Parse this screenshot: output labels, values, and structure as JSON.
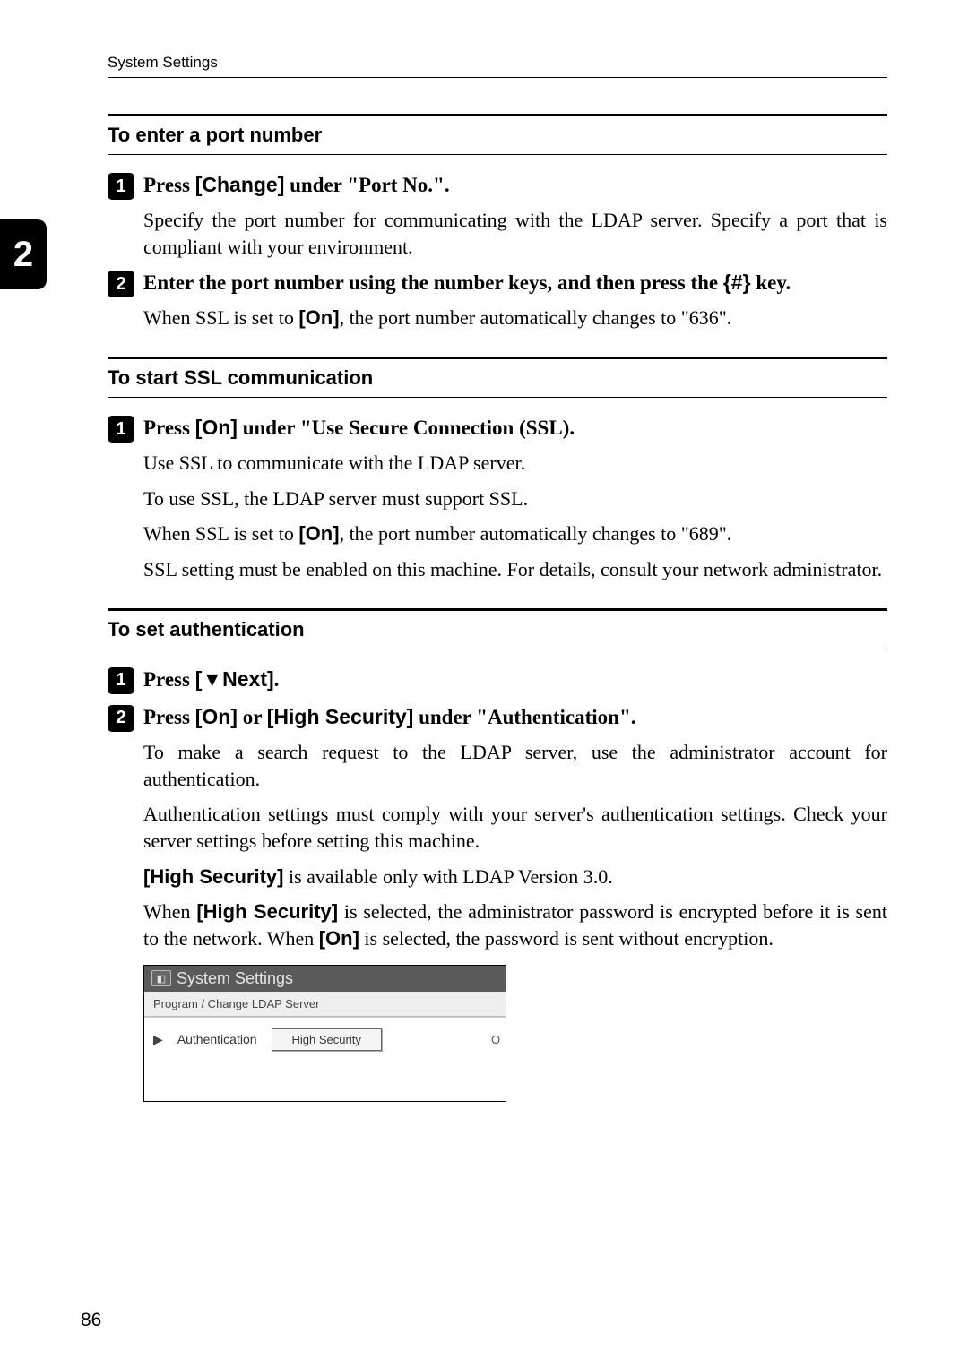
{
  "running_head": "System Settings",
  "chapter_tab": "2",
  "page_number": "86",
  "sections": {
    "port": {
      "title": "To enter a port number",
      "step1": {
        "pre": "Press ",
        "btn": "[Change]",
        "post": " under \"Port No.\"."
      },
      "body1": "Specify the port number for communicating with the LDAP server. Specify a port that is compliant with your environment.",
      "step2": {
        "pre": "Enter the port number using the number keys, and then press the ",
        "key": "{#}",
        "post": " key."
      },
      "body2a": "When SSL is set to ",
      "body2btn": "[On]",
      "body2b": ", the port number automatically changes to \"636\"."
    },
    "ssl": {
      "title": "To start SSL communication",
      "step1": {
        "pre": "Press ",
        "btn": "[On]",
        "post": " under \"Use Secure Connection (SSL)."
      },
      "body1": "Use SSL to communicate with the LDAP server.",
      "body2": "To use SSL, the LDAP server must support SSL.",
      "body3a": "When SSL is set to ",
      "body3btn": "[On]",
      "body3b": ", the port number automatically changes to \"689\".",
      "body4": "SSL setting must be enabled on this machine. For details, consult your network administrator."
    },
    "auth": {
      "title": "To set authentication",
      "step1": {
        "pre": "Press ",
        "btn": "[▼Next]",
        "post": "."
      },
      "step2": {
        "pre": "Press ",
        "btn1": "[On]",
        "mid": " or ",
        "btn2": "[High Security]",
        "post": " under \"Authentication\"."
      },
      "body1": "To make a search request to the LDAP server, use the administrator account for authentication.",
      "body2": "Authentication settings must comply with your server's authentication settings. Check your server settings before setting this machine.",
      "body3a": "",
      "body3btn": "[High Security]",
      "body3b": " is available only with LDAP Version 3.0.",
      "body4a": "When ",
      "body4btn1": "[High Security]",
      "body4b": " is selected, the administrator password is encrypted before it is sent to the network. When ",
      "body4btn2": "[On]",
      "body4c": " is selected, the password is sent without encryption."
    }
  },
  "screenshot": {
    "title": "System Settings",
    "subtitle": "Program / Change LDAP Server",
    "row_label": "Authentication",
    "button": "High Security",
    "cut": "O"
  }
}
